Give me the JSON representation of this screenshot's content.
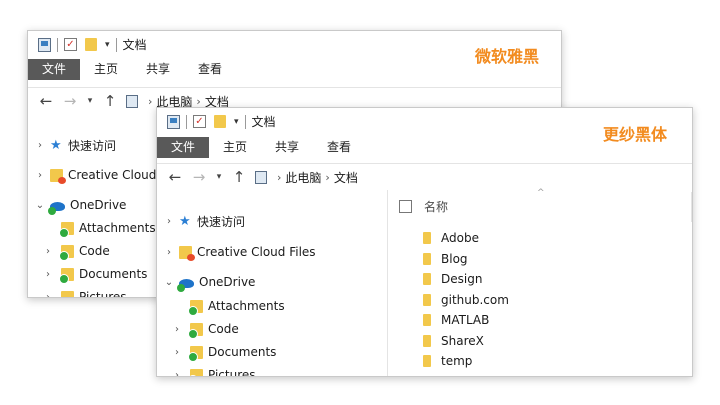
{
  "window1": {
    "title": "文档",
    "font_label": "微软雅黑",
    "ribbon": [
      "文件",
      "主页",
      "共享",
      "查看"
    ],
    "address": [
      "此电脑",
      "文档"
    ],
    "tree": [
      "快速访问",
      "Creative Cloud Files",
      "OneDrive",
      "Attachments",
      "Code",
      "Documents",
      "Pictures"
    ]
  },
  "window2": {
    "title": "文档",
    "font_label": "更纱黑体",
    "ribbon": [
      "文件",
      "主页",
      "共享",
      "查看"
    ],
    "address": [
      "此电脑",
      "文档"
    ],
    "tree": [
      "快速访问",
      "Creative Cloud Files",
      "OneDrive",
      "Attachments",
      "Code",
      "Documents",
      "Pictures"
    ],
    "column_name": "名称",
    "files": [
      "Adobe",
      "Blog",
      "Design",
      "github.com",
      "MATLAB",
      "ShareX",
      "temp"
    ]
  },
  "colors": {
    "accent": "#f28b1f",
    "file_tab": "#595959",
    "folder": "#f2c84b",
    "sync": "#2faa3f",
    "onedrive": "#1e73c9"
  },
  "icons": [
    "this-pc-icon",
    "properties-check-icon",
    "new-folder-icon",
    "quick-access-star-icon",
    "creative-cloud-folder-icon",
    "onedrive-cloud-icon",
    "folder-icon",
    "sync-check-icon"
  ]
}
